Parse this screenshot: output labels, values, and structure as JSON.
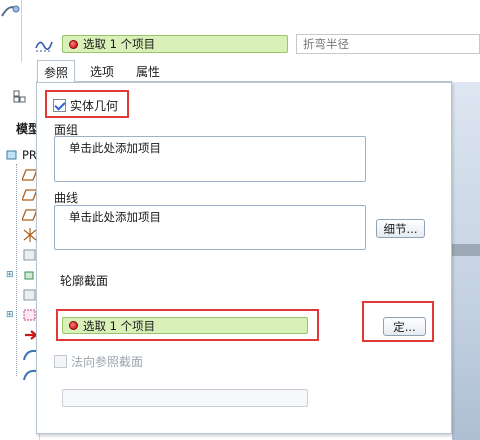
{
  "toolbar": {
    "selection_field": "选取 1 个项目",
    "radius_placeholder": "折弯半径"
  },
  "tabs": [
    {
      "label": "参照",
      "active": true
    },
    {
      "label": "选项",
      "active": false
    },
    {
      "label": "属性",
      "active": false
    }
  ],
  "model_tree": {
    "title": "模型",
    "root_label": "PR"
  },
  "panel": {
    "solid_geometry": {
      "label": "实体几何",
      "checked": true
    },
    "quilt": {
      "label": "面组",
      "collector_text": "单击此处添加项目"
    },
    "curve": {
      "label": "曲线",
      "collector_text": "单击此处添加项目",
      "details_button": "细节..."
    },
    "profile_section": {
      "label": "轮廓截面",
      "selection_field": "选取 1 个项目",
      "define_button": "定..."
    },
    "normal_to_ref": {
      "label": "法向参照截面",
      "checked": false,
      "enabled": false
    }
  },
  "colors": {
    "selection_green": "#d9f0b8",
    "highlight_red": "#e23838",
    "panel_border": "#b9c4d1"
  }
}
